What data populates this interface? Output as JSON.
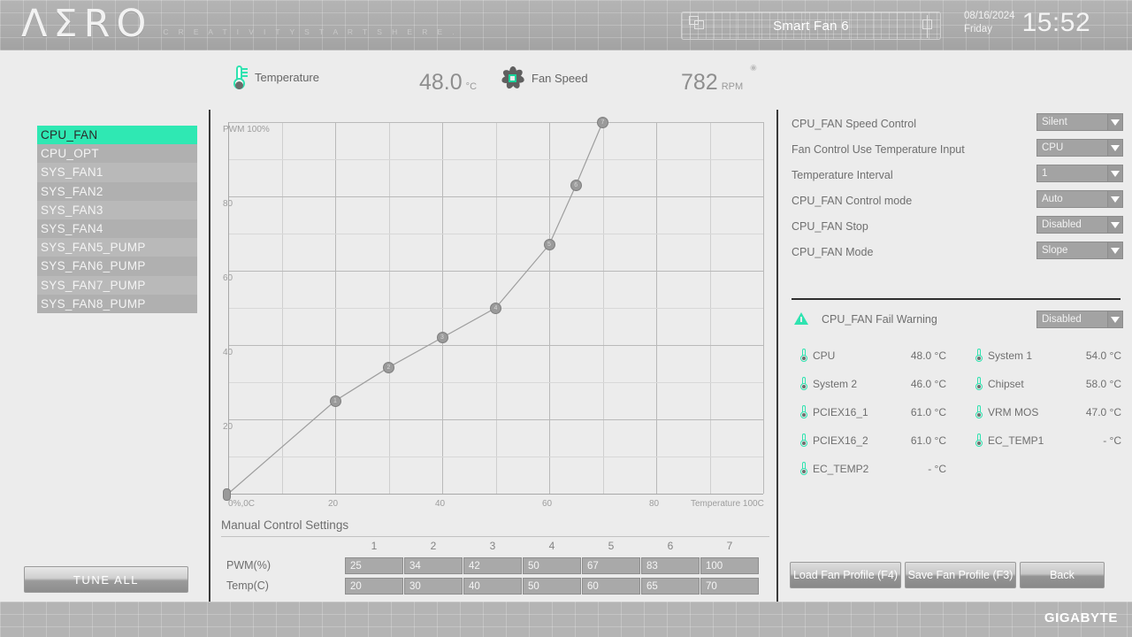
{
  "header": {
    "logo": "ΛΣRO",
    "tagline": "C R E A T I V I T Y    S T A R T S    H E R E .",
    "title": "Smart Fan 6",
    "date": "08/16/2024",
    "weekday": "Friday",
    "time": "15:52",
    "accent_color": "#2fe3b0"
  },
  "sensorbar": {
    "temperature_label": "Temperature",
    "temperature_value": "48.0",
    "temperature_unit": "°C",
    "fanspeed_label": "Fan Speed",
    "fanspeed_value": "782",
    "fanspeed_unit": "RPM"
  },
  "fanlist": {
    "items": [
      {
        "label": "CPU_FAN",
        "selected": true
      },
      {
        "label": "CPU_OPT",
        "selected": false
      },
      {
        "label": "SYS_FAN1",
        "selected": false
      },
      {
        "label": "SYS_FAN2",
        "selected": false
      },
      {
        "label": "SYS_FAN3",
        "selected": false
      },
      {
        "label": "SYS_FAN4",
        "selected": false
      },
      {
        "label": "SYS_FAN5_PUMP",
        "selected": false
      },
      {
        "label": "SYS_FAN6_PUMP",
        "selected": false
      },
      {
        "label": "SYS_FAN7_PUMP",
        "selected": false
      },
      {
        "label": "SYS_FAN8_PUMP",
        "selected": false
      }
    ],
    "tune_all_label": "TUNE ALL"
  },
  "chart_data": {
    "type": "line",
    "title": "",
    "xlabel": "Temperature 100C",
    "ylabel": "PWM 100%",
    "xlim": [
      0,
      100
    ],
    "ylim": [
      0,
      100
    ],
    "grid": true,
    "x_ticks": [
      "0%,0C",
      "20",
      "40",
      "60",
      "80",
      "Temperature 100C"
    ],
    "x_tick_values": [
      0,
      20,
      40,
      60,
      80,
      100
    ],
    "y_ticks": [
      "PWM 100%",
      "80",
      "60",
      "40",
      "20"
    ],
    "y_tick_values": [
      100,
      80,
      60,
      40,
      20
    ],
    "x": [
      20,
      30,
      40,
      50,
      60,
      65,
      70
    ],
    "values": [
      25,
      34,
      42,
      50,
      67,
      83,
      100
    ],
    "point_labels": [
      "1",
      "2",
      "3",
      "4",
      "5",
      "6",
      "7"
    ],
    "origin_point": {
      "x": 0,
      "y": 0
    }
  },
  "manual_control": {
    "title": "Manual Control Settings",
    "columns": [
      "1",
      "2",
      "3",
      "4",
      "5",
      "6",
      "7"
    ],
    "rows": [
      {
        "label": "PWM(%)",
        "values": [
          "25",
          "34",
          "42",
          "50",
          "67",
          "83",
          "100"
        ]
      },
      {
        "label": "Temp(C)",
        "values": [
          "20",
          "30",
          "40",
          "50",
          "60",
          "65",
          "70"
        ]
      }
    ]
  },
  "settings": {
    "rows": [
      {
        "label": "CPU_FAN Speed Control",
        "value": "Silent"
      },
      {
        "label": "Fan Control Use Temperature Input",
        "value": "CPU"
      },
      {
        "label": "Temperature Interval",
        "value": "1"
      },
      {
        "label": "CPU_FAN Control mode",
        "value": "Auto"
      },
      {
        "label": "CPU_FAN Stop",
        "value": "Disabled"
      },
      {
        "label": "CPU_FAN Mode",
        "value": "Slope"
      }
    ]
  },
  "fail_warning": {
    "label": "CPU_FAN Fail Warning",
    "value": "Disabled"
  },
  "temperatures": [
    {
      "name": "CPU",
      "value": "48.0 °C"
    },
    {
      "name": "System 1",
      "value": "54.0 °C"
    },
    {
      "name": "System 2",
      "value": "46.0 °C"
    },
    {
      "name": "Chipset",
      "value": "58.0 °C"
    },
    {
      "name": "PCIEX16_1",
      "value": "61.0 °C"
    },
    {
      "name": "VRM MOS",
      "value": "47.0 °C"
    },
    {
      "name": "PCIEX16_2",
      "value": "61.0 °C"
    },
    {
      "name": "EC_TEMP1",
      "value": "- °C"
    },
    {
      "name": "EC_TEMP2",
      "value": "- °C"
    }
  ],
  "buttons": {
    "load": "Load Fan Profile (F4)",
    "save": "Save Fan Profile (F3)",
    "back": "Back"
  },
  "footer": {
    "brand": "GIGABYTE"
  }
}
